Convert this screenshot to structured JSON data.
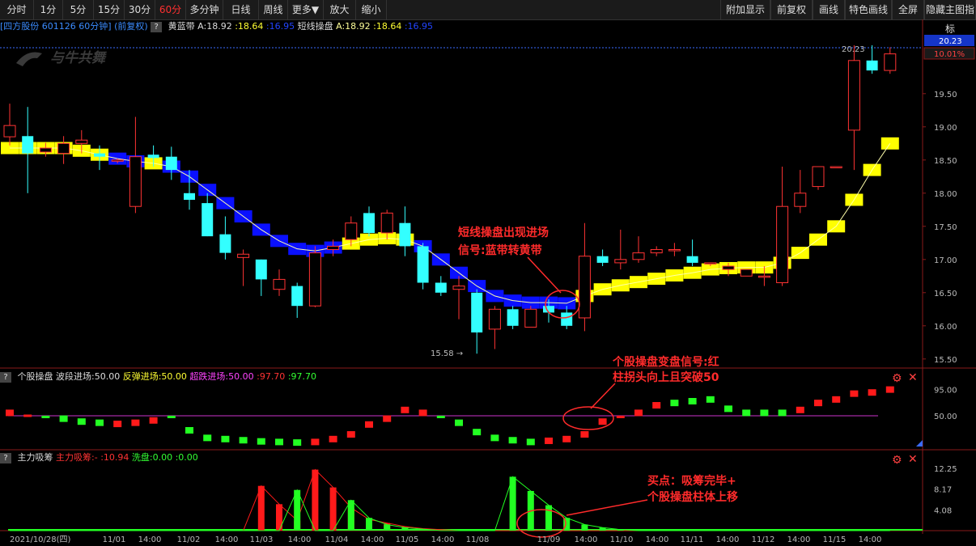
{
  "toolbar": {
    "left": [
      "分时",
      "1分",
      "5分",
      "15分",
      "30分",
      "60分",
      "多分钟",
      "日线",
      "周线",
      "更多▼",
      "放大",
      "缩小"
    ],
    "active": "60分",
    "right": [
      "附加显示",
      "前复权",
      "画线",
      "特色画线",
      "全屏",
      "隐藏主图指标"
    ]
  },
  "info": {
    "stock": "[四方股份 601126 60分钟]",
    "adjust": "(前复权)",
    "q": "?",
    "ind1_name": "黄蓝带",
    "ind1_a": "A:18.92",
    "ind1_v1": ":18.64",
    "ind1_v2": ":16.95",
    "ind2_name": "短线操盘",
    "ind2_a": "A:18.92",
    "ind2_v1": ":18.64",
    "ind2_v2": ":16.95"
  },
  "logo_text": "与牛共舞",
  "main_axis": {
    "labels": [
      "19.50",
      "19.00",
      "18.50",
      "18.00",
      "17.50",
      "17.00",
      "16.50",
      "16.00",
      "15.50"
    ],
    "ymin": 15.4,
    "ymax": 20.4,
    "price_tag": "20.23",
    "pct_tag": "10.01%",
    "high_label": "20.23",
    "low_label": "15.58"
  },
  "panel2": {
    "q": "?",
    "name": "个股操盘",
    "a": "波段进场:50.00",
    "b": "反弹进场:50.00",
    "c": "超跌进场:50.00",
    "d": ":97.70",
    "e": ":97.70",
    "labels": [
      "95.00",
      "50.00"
    ]
  },
  "panel3": {
    "q": "?",
    "name": "主力吸筹",
    "a": "主力吸筹:-",
    "b": ":10.94",
    "c": "洗盘:0.00",
    "d": ":0.00",
    "labels": [
      "12.25",
      "8.17",
      "4.08"
    ]
  },
  "xaxis": [
    "2021/10/28(四)",
    "11/01",
    "14:00",
    "11/02",
    "14:00",
    "11/03",
    "14:00",
    "11/04",
    "14:00",
    "11/05",
    "14:00",
    "11/08",
    "11/09",
    "14:00",
    "11/10",
    "14:00",
    "11/11",
    "14:00",
    "11/12",
    "14:00",
    "11/15",
    "14:00"
  ],
  "annotations": {
    "a1_line1": "短线操盘出现进场",
    "a1_line2": "信号:蓝带转黄带",
    "a2_line1": "个股操盘变盘信号:红",
    "a2_line2": "柱拐头向上且突破50",
    "a3_line1": "买点：吸筹完毕+",
    "a3_line2": "个股操盘柱体上移"
  },
  "colors": {
    "up": "#ff3333",
    "down": "#33ffff",
    "blue_band": "#0a10ff",
    "yellow_band": "#ffff00",
    "ma": "#ffffaa",
    "green": "#22ff22",
    "red": "#ff1a1a",
    "purple": "#cc33cc"
  },
  "chart_data": {
    "type": "candlestick",
    "candles": [
      [
        18.85,
        19.02,
        19.35,
        18.72
      ],
      [
        18.86,
        18.6,
        19.3,
        18.0
      ],
      [
        18.62,
        18.68,
        18.76,
        18.55
      ],
      [
        18.6,
        18.75,
        18.86,
        18.44
      ],
      [
        18.75,
        18.8,
        18.95,
        18.6
      ],
      [
        18.6,
        18.55,
        18.72,
        18.35
      ],
      [
        18.5,
        18.5,
        18.52,
        18.45
      ],
      [
        17.8,
        18.55,
        19.15,
        17.7
      ],
      [
        18.58,
        18.53,
        18.72,
        18.4
      ],
      [
        18.55,
        18.35,
        18.7,
        18.2
      ],
      [
        18.0,
        17.9,
        18.35,
        17.75
      ],
      [
        17.85,
        17.35,
        18.0,
        17.35
      ],
      [
        17.38,
        17.1,
        17.65,
        17.0
      ],
      [
        17.03,
        17.08,
        17.15,
        16.6
      ],
      [
        17.0,
        16.7,
        17.0,
        16.45
      ],
      [
        16.55,
        16.7,
        16.85,
        16.45
      ],
      [
        16.6,
        16.3,
        16.65,
        16.12
      ],
      [
        16.3,
        17.1,
        17.2,
        16.28
      ],
      [
        17.15,
        17.2,
        17.3,
        17.05
      ],
      [
        17.3,
        17.55,
        17.65,
        17.2
      ],
      [
        17.7,
        17.4,
        17.8,
        17.35
      ],
      [
        17.4,
        17.7,
        17.75,
        17.3
      ],
      [
        17.55,
        17.2,
        17.8,
        17.05
      ],
      [
        17.2,
        16.65,
        17.25,
        16.55
      ],
      [
        16.65,
        16.5,
        16.75,
        16.45
      ],
      [
        16.55,
        16.6,
        16.75,
        16.1
      ],
      [
        16.5,
        15.9,
        16.55,
        15.58
      ],
      [
        15.95,
        16.25,
        16.3,
        15.65
      ],
      [
        16.25,
        16.0,
        16.3,
        15.95
      ],
      [
        15.98,
        16.25,
        16.3,
        15.98
      ],
      [
        16.3,
        16.2,
        16.4,
        16.05
      ],
      [
        16.2,
        16.0,
        16.3,
        15.95
      ],
      [
        16.12,
        17.05,
        17.55,
        15.92
      ],
      [
        17.05,
        16.95,
        17.15,
        16.9
      ],
      [
        16.95,
        17.0,
        17.45,
        16.85
      ],
      [
        17.0,
        17.1,
        17.35,
        16.95
      ],
      [
        17.1,
        17.15,
        17.2,
        17.05
      ],
      [
        17.15,
        17.15,
        17.25,
        17.05
      ],
      [
        17.05,
        16.95,
        17.3,
        16.9
      ],
      [
        16.95,
        16.95,
        16.95,
        16.9
      ],
      [
        16.85,
        16.9,
        16.95,
        16.75
      ],
      [
        16.75,
        16.85,
        16.85,
        16.75
      ],
      [
        16.75,
        16.75,
        16.9,
        16.6
      ],
      [
        16.65,
        17.8,
        18.4,
        16.6
      ],
      [
        17.8,
        18.0,
        18.35,
        17.7
      ],
      [
        18.1,
        18.4,
        18.4,
        18.05
      ],
      [
        18.4,
        18.4,
        18.4,
        18.4
      ],
      [
        18.95,
        20.0,
        20.23,
        18.35
      ],
      [
        20.0,
        19.85,
        20.23,
        19.8
      ],
      [
        19.85,
        20.1,
        20.2,
        19.8
      ]
    ],
    "band_values": [
      18.68,
      18.68,
      18.68,
      18.68,
      18.64,
      18.58,
      18.52,
      18.48,
      18.45,
      18.4,
      18.25,
      18.05,
      17.85,
      17.65,
      17.45,
      17.28,
      17.16,
      17.13,
      17.18,
      17.24,
      17.3,
      17.32,
      17.3,
      17.2,
      17.0,
      16.8,
      16.6,
      16.45,
      16.38,
      16.35,
      16.35,
      16.34,
      16.45,
      16.55,
      16.61,
      16.66,
      16.71,
      16.76,
      16.8,
      16.85,
      16.87,
      16.88,
      16.88,
      16.95,
      17.1,
      17.3,
      17.5,
      17.9,
      18.35,
      18.75
    ],
    "band_colors": [
      "y",
      "y",
      "y",
      "y",
      "y",
      "y",
      "b",
      "b",
      "y",
      "b",
      "b",
      "b",
      "b",
      "b",
      "b",
      "b",
      "b",
      "b",
      "b",
      "y",
      "y",
      "y",
      "y",
      "b",
      "b",
      "b",
      "b",
      "b",
      "b",
      "b",
      "b",
      "b",
      "y",
      "y",
      "y",
      "y",
      "y",
      "y",
      "y",
      "y",
      "y",
      "y",
      "y",
      "y",
      "y",
      "y",
      "y",
      "y",
      "y",
      "y"
    ],
    "oscillator": [
      55,
      50,
      48,
      45,
      40,
      38,
      36,
      38,
      42,
      48,
      25,
      12,
      10,
      8,
      6,
      5,
      4,
      5,
      10,
      18,
      35,
      45,
      60,
      55,
      48,
      38,
      22,
      12,
      8,
      5,
      7,
      10,
      18,
      40,
      48,
      55,
      68,
      72,
      75,
      78,
      62,
      55,
      55,
      55,
      60,
      72,
      78,
      88,
      90,
      95
    ],
    "oscillator_colors": [
      "r",
      "r",
      "g",
      "g",
      "g",
      "g",
      "r",
      "r",
      "r",
      "g",
      "g",
      "g",
      "g",
      "g",
      "g",
      "g",
      "g",
      "r",
      "r",
      "r",
      "r",
      "r",
      "r",
      "r",
      "g",
      "g",
      "g",
      "g",
      "g",
      "g",
      "r",
      "r",
      "r",
      "r",
      "r",
      "r",
      "r",
      "g",
      "g",
      "g",
      "g",
      "g",
      "g",
      "g",
      "r",
      "r",
      "r",
      "r",
      "r",
      "r"
    ],
    "absorb": [
      0,
      0,
      0,
      0,
      0,
      0,
      0,
      0,
      0,
      0,
      0,
      0,
      0,
      0,
      8.8,
      5.2,
      2.0,
      12.0,
      8.5,
      4.5,
      2.2,
      1.5,
      0.8,
      0.4,
      0.2,
      0,
      0,
      0,
      0,
      0,
      0,
      0,
      0,
      0,
      0,
      0,
      0,
      0,
      0,
      0,
      0,
      0,
      0,
      0,
      0,
      0,
      0,
      0,
      0,
      0
    ],
    "absorb_wash": [
      0,
      0,
      0,
      0,
      0,
      0,
      0,
      0,
      0,
      0,
      0,
      0,
      0,
      0,
      0,
      0,
      8.0,
      0,
      0,
      6.0,
      2.5,
      1.2,
      0.6,
      0.3,
      0,
      0,
      0,
      0,
      10.6,
      7.8,
      5.0,
      2.5,
      1.2,
      0.6,
      0.2,
      0,
      0,
      0,
      0,
      0,
      0,
      0,
      0,
      0,
      0,
      0,
      0,
      0,
      0,
      0
    ]
  }
}
